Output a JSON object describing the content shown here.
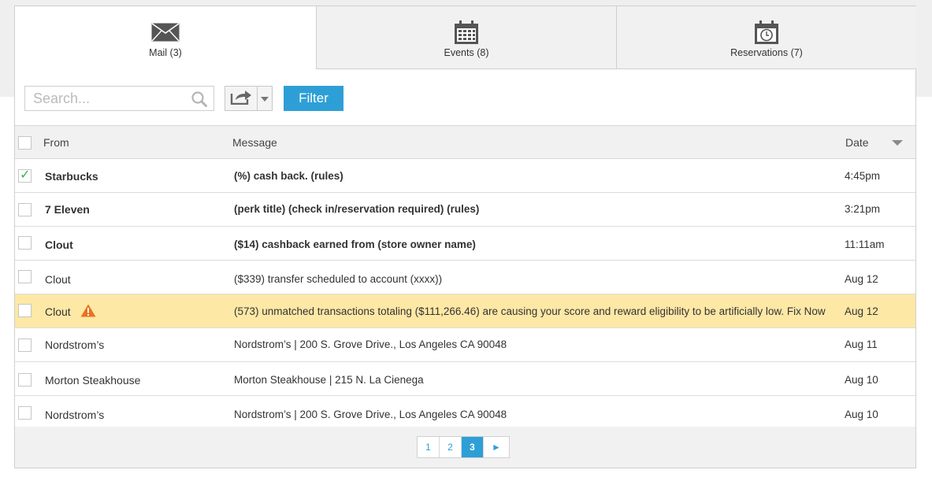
{
  "tabs": [
    {
      "label": "Mail (3)",
      "icon": "envelope-icon",
      "active": true
    },
    {
      "label": "Events (8)",
      "icon": "calendar-icon",
      "active": false
    },
    {
      "label": "Reservations (7)",
      "icon": "calendar-clock-icon",
      "active": false
    }
  ],
  "toolbar": {
    "search_placeholder": "Search...",
    "filter_label": "Filter"
  },
  "table": {
    "headers": {
      "from": "From",
      "message": "Message",
      "date": "Date"
    },
    "rows": [
      {
        "from": "Starbucks",
        "message": "(%) cash back.  (rules)",
        "date": "4:45pm",
        "checked": true,
        "unread": true
      },
      {
        "from": "7 Eleven",
        "message": "(perk title) (check in/reservation required) (rules)",
        "date": "3:21pm",
        "checked": false,
        "unread": true
      },
      {
        "from": "Clout",
        "message": "($14) cashback earned from (store owner name)",
        "date": "11:11am",
        "checked": false,
        "unread": true
      },
      {
        "from": "Clout",
        "message": "($339) transfer scheduled to account (xxxx))",
        "date": "Aug 12",
        "checked": false,
        "unread": false
      },
      {
        "from": "Clout",
        "message": "(573) unmatched transactions totaling ($111,266.46) are causing your score and reward eligibility to be artificially low. Fix Now",
        "date": "Aug 12",
        "checked": false,
        "unread": false,
        "warning": true
      },
      {
        "from": "Nordstrom’s",
        "message": "Nordstrom’s  |  200 S. Grove Drive., Los Angeles CA 90048",
        "date": "Aug 11",
        "checked": false,
        "unread": false
      },
      {
        "from": "Morton Steakhouse",
        "message": "Morton Steakhouse  |  215 N. La Cienega",
        "date": "Aug 10",
        "checked": false,
        "unread": false
      },
      {
        "from": "Nordstrom’s",
        "message": "Nordstrom’s  |  200 S. Grove Drive., Los Angeles CA 90048",
        "date": "Aug 10",
        "checked": false,
        "unread": false
      }
    ]
  },
  "pagination": {
    "pages": [
      "1",
      "2",
      "3"
    ],
    "current": "3",
    "next_label": "►"
  },
  "colors": {
    "accent": "#2e9fd6",
    "warning_row": "#fde8a6",
    "warning_icon": "#e8731e",
    "check": "#3bb54a"
  }
}
